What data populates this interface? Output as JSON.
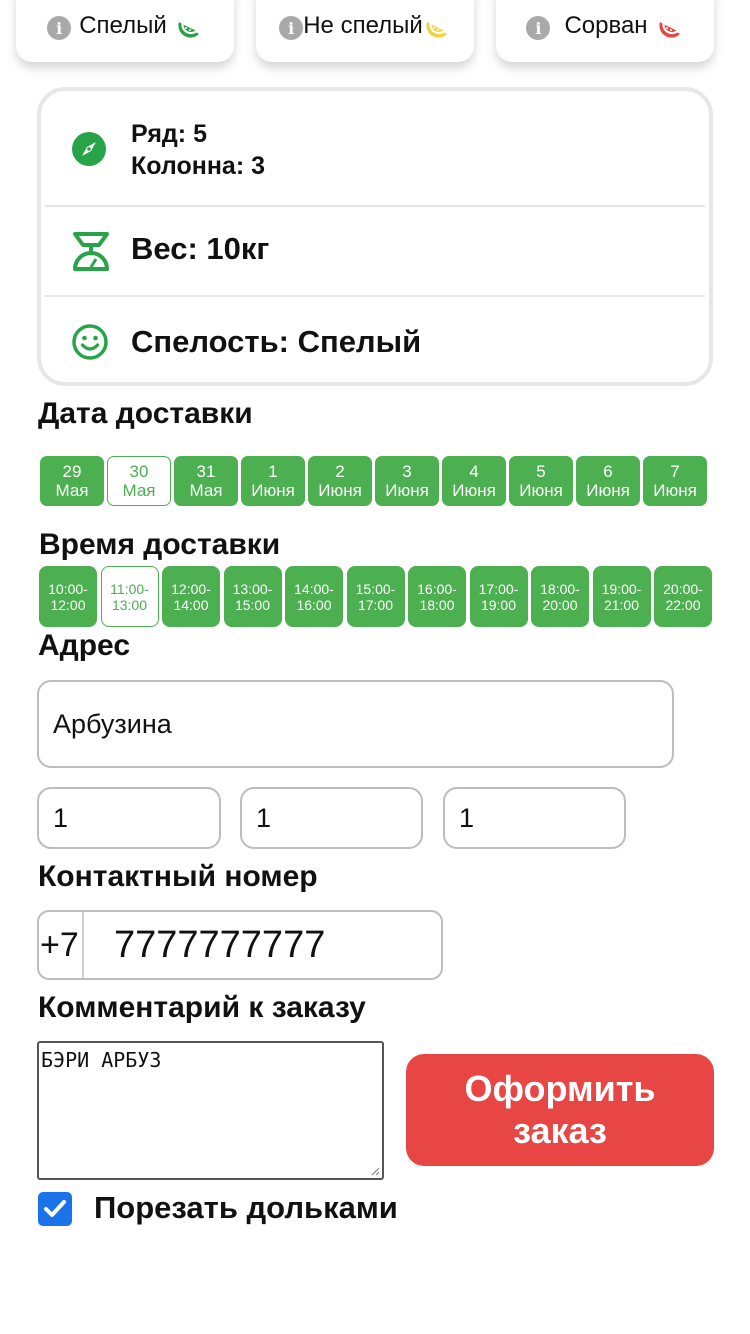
{
  "legend": [
    {
      "label": "Спелый",
      "icon": "watermelon-slice-icon",
      "color": "#2e9e48"
    },
    {
      "label": "Не спелый",
      "icon": "watermelon-slice-icon",
      "color": "#f2d23a"
    },
    {
      "label": "Сорван",
      "icon": "watermelon-slice-icon",
      "color": "#e84545"
    }
  ],
  "info": {
    "row_label": "Ряд: 5",
    "column_label": "Колонна: 3",
    "weight": "Вес: 10кг",
    "ripeness": "Спелость: Спелый"
  },
  "delivery_date": {
    "title": "Дата доставки",
    "selected_index": 1,
    "options": [
      {
        "day": "29",
        "month": "Мая"
      },
      {
        "day": "30",
        "month": "Мая"
      },
      {
        "day": "31",
        "month": "Мая"
      },
      {
        "day": "1",
        "month": "Июня"
      },
      {
        "day": "2",
        "month": "Июня"
      },
      {
        "day": "3",
        "month": "Июня"
      },
      {
        "day": "4",
        "month": "Июня"
      },
      {
        "day": "5",
        "month": "Июня"
      },
      {
        "day": "6",
        "month": "Июня"
      },
      {
        "day": "7",
        "month": "Июня"
      }
    ]
  },
  "delivery_time": {
    "title": "Время доставки",
    "selected_index": 1,
    "options": [
      {
        "from": "10:00-",
        "to": "12:00"
      },
      {
        "from": "11:00-",
        "to": "13:00"
      },
      {
        "from": "12:00-",
        "to": "14:00"
      },
      {
        "from": "13:00-",
        "to": "15:00"
      },
      {
        "from": "14:00-",
        "to": "16:00"
      },
      {
        "from": "15:00-",
        "to": "17:00"
      },
      {
        "from": "16:00-",
        "to": "18:00"
      },
      {
        "from": "17:00-",
        "to": "19:00"
      },
      {
        "from": "18:00-",
        "to": "20:00"
      },
      {
        "from": "19:00-",
        "to": "21:00"
      },
      {
        "from": "20:00-",
        "to": "22:00"
      }
    ]
  },
  "address": {
    "title": "Адрес",
    "street": "Арбузина",
    "house": "1",
    "entrance": "1",
    "apartment": "1"
  },
  "contact": {
    "title": "Контактный номер",
    "prefix": "+7",
    "number": "7777777777"
  },
  "comment": {
    "title": "Комментарий к заказу",
    "value": "БЭРИ АРБУЗ"
  },
  "order_button": "Оформить заказ",
  "slice_option": {
    "label": "Порезать дольками",
    "checked": true
  },
  "colors": {
    "accent": "#4caf50",
    "danger": "#e84545",
    "checkbox": "#1a73e8"
  }
}
